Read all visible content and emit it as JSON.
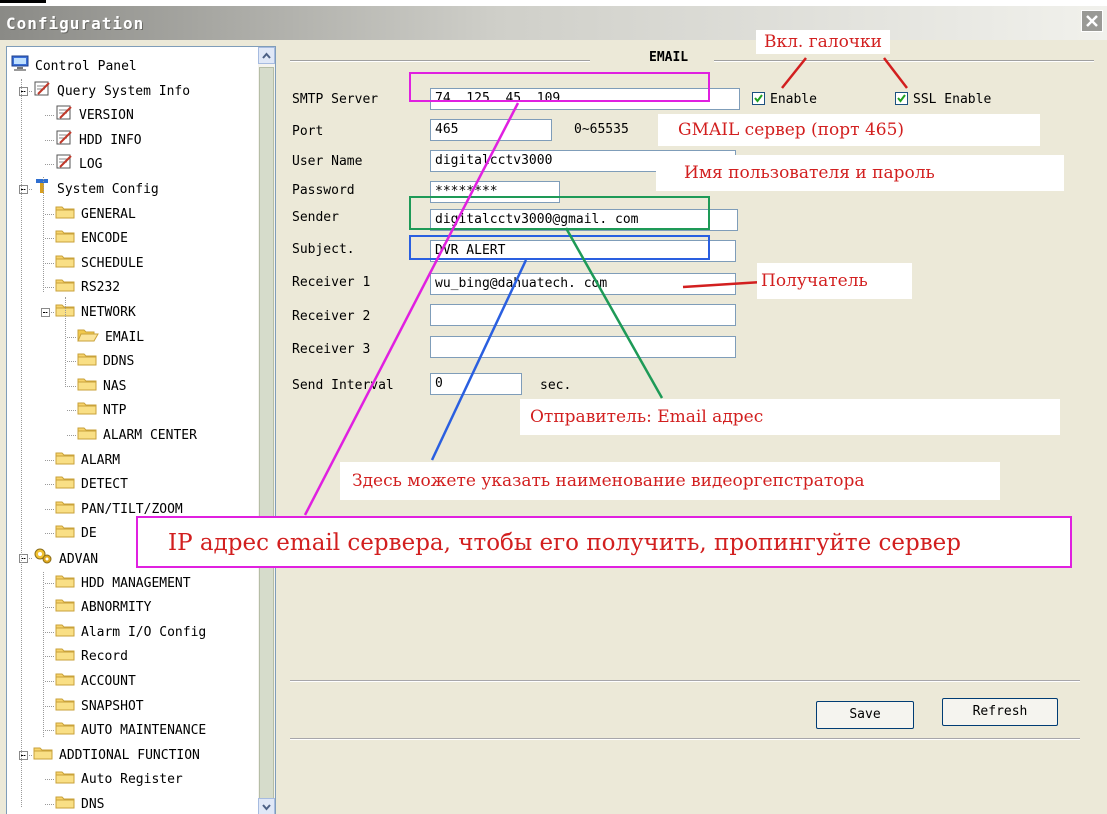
{
  "window": {
    "title": "Configuration"
  },
  "tree": {
    "items": [
      {
        "label": "Control Panel",
        "icon": "computer-icon"
      },
      {
        "label": "Query System Info",
        "icon": "notepad-icon"
      },
      {
        "label": "VERSION",
        "icon": "notepad-icon"
      },
      {
        "label": "HDD INFO",
        "icon": "notepad-icon"
      },
      {
        "label": "LOG",
        "icon": "notepad-icon"
      },
      {
        "label": "System Config",
        "icon": "tools-icon"
      },
      {
        "label": "GENERAL",
        "icon": "folder-icon"
      },
      {
        "label": "ENCODE",
        "icon": "folder-icon"
      },
      {
        "label": "SCHEDULE",
        "icon": "folder-icon"
      },
      {
        "label": "RS232",
        "icon": "folder-icon"
      },
      {
        "label": "NETWORK",
        "icon": "folder-icon"
      },
      {
        "label": "EMAIL",
        "icon": "folder-open-icon"
      },
      {
        "label": "DDNS",
        "icon": "folder-icon"
      },
      {
        "label": "NAS",
        "icon": "folder-icon"
      },
      {
        "label": "NTP",
        "icon": "folder-icon"
      },
      {
        "label": "ALARM CENTER",
        "icon": "folder-icon"
      },
      {
        "label": "ALARM",
        "icon": "folder-icon"
      },
      {
        "label": "DETECT",
        "icon": "folder-icon"
      },
      {
        "label": "PAN/TILT/ZOOM",
        "icon": "folder-icon"
      },
      {
        "label": "DE",
        "icon": "folder-icon"
      },
      {
        "label": "ADVAN",
        "icon": "gears-icon"
      },
      {
        "label": "HDD MANAGEMENT",
        "icon": "folder-icon"
      },
      {
        "label": "ABNORMITY",
        "icon": "folder-icon"
      },
      {
        "label": "Alarm I/O Config",
        "icon": "folder-icon"
      },
      {
        "label": "Record",
        "icon": "folder-icon"
      },
      {
        "label": "ACCOUNT",
        "icon": "folder-icon"
      },
      {
        "label": "SNAPSHOT",
        "icon": "folder-icon"
      },
      {
        "label": "AUTO MAINTENANCE",
        "icon": "folder-icon"
      },
      {
        "label": "ADDTIONAL FUNCTION",
        "icon": "folder-icon"
      },
      {
        "label": "Auto Register",
        "icon": "folder-icon"
      },
      {
        "label": "DNS",
        "icon": "folder-icon"
      }
    ]
  },
  "email": {
    "section_title": "EMAIL",
    "smtp_label": "SMTP Server",
    "smtp_value": "74. 125. 45. 109",
    "enable_label": "Enable",
    "ssl_label": "SSL Enable",
    "port_label": "Port",
    "port_value": "465",
    "port_range": "0~65535",
    "username_label": "User Name",
    "username_value": "digitalcctv3000",
    "password_label": "Password",
    "password_value": "********",
    "sender_label": "Sender",
    "sender_value": "digitalcctv3000@gmail. com",
    "subject_label": "Subject.",
    "subject_value": "DVR ALERT",
    "receiver1_label": "Receiver 1",
    "receiver1_value": "wu_bing@dahuatech. com",
    "receiver2_label": "Receiver 2",
    "receiver2_value": "",
    "receiver3_label": "Receiver 3",
    "receiver3_value": "",
    "interval_label": "Send Interval",
    "interval_value": "0",
    "interval_unit": "sec.",
    "enable_checked": true,
    "ssl_checked": true
  },
  "buttons": {
    "save": "Save",
    "refresh": "Refresh"
  },
  "annotations": {
    "checkmarks": "Вкл. галочки",
    "gmail": "GMAIL сервер (порт 465)",
    "userpass": "Имя пользователя и пароль",
    "receiver": "Получатель",
    "sender": "Отправитель: Email адрес",
    "subject": "Здесь можете указать наименование видеоргепстратора",
    "ip": "IP адрес email сервера, чтобы его получить, пропингуйте сервер"
  },
  "colors": {
    "magenta": "#e020e0",
    "green": "#1e9a57",
    "blue": "#2a5fe0",
    "red": "#d21f1f"
  }
}
